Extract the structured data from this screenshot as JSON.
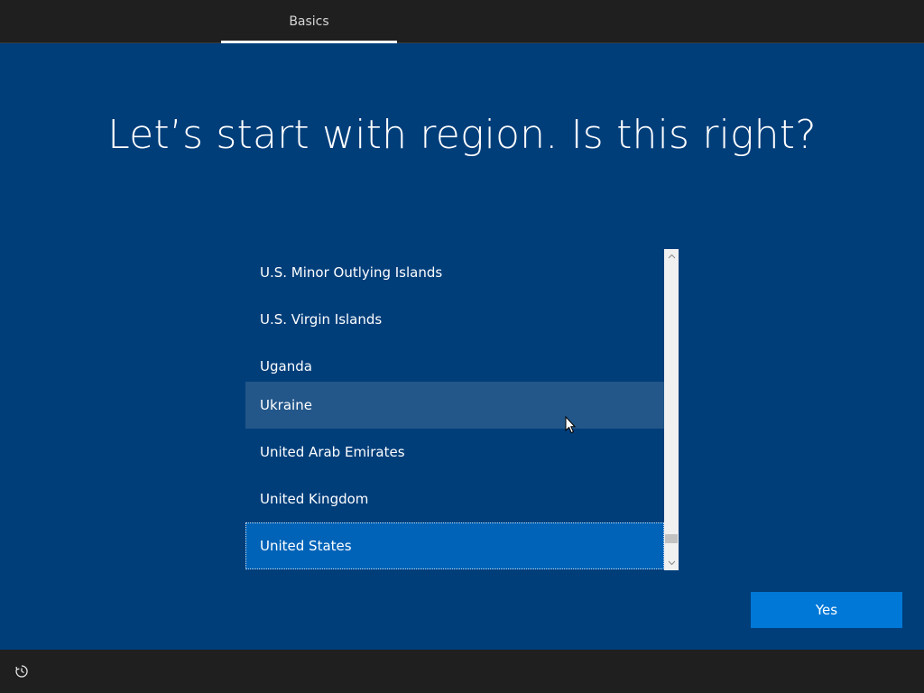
{
  "header": {
    "tabs": [
      {
        "label": "Basics",
        "active": true
      }
    ]
  },
  "main": {
    "title": "Let’s start with region. Is this right?",
    "region_list": {
      "items": [
        {
          "label": "U.S. Minor Outlying Islands",
          "state": "normal"
        },
        {
          "label": "U.S. Virgin Islands",
          "state": "normal"
        },
        {
          "label": "Uganda",
          "state": "normal"
        },
        {
          "label": "Ukraine",
          "state": "hovered"
        },
        {
          "label": "United Arab Emirates",
          "state": "normal"
        },
        {
          "label": "United Kingdom",
          "state": "normal"
        },
        {
          "label": "United States",
          "state": "selected"
        }
      ],
      "selected": "United States"
    },
    "yes_label": "Yes"
  },
  "footer": {
    "icon": "accessibility-icon"
  },
  "colors": {
    "background": "#003e7a",
    "bar": "#1f1f1f",
    "accent": "#0078d7",
    "selected_item": "#0063b8",
    "hover_item": "#23578a"
  }
}
